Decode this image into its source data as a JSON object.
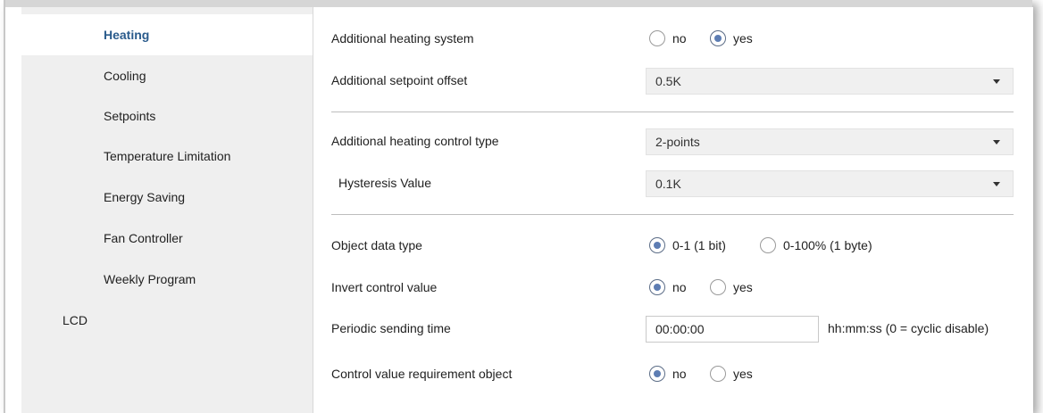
{
  "sidebar": {
    "items": [
      {
        "label": "Heating"
      },
      {
        "label": "Cooling"
      },
      {
        "label": "Setpoints"
      },
      {
        "label": "Temperature Limitation"
      },
      {
        "label": "Energy Saving"
      },
      {
        "label": "Fan Controller"
      },
      {
        "label": "Weekly Program"
      },
      {
        "label": "LCD"
      }
    ],
    "active_index": 0
  },
  "form": {
    "additional_heating_system": {
      "label": "Additional heating system",
      "options": [
        "no",
        "yes"
      ],
      "selected": "yes"
    },
    "additional_setpoint_offset": {
      "label": "Additional setpoint offset",
      "value": "0.5K"
    },
    "additional_heating_control_type": {
      "label": "Additional heating control type",
      "value": "2-points"
    },
    "hysteresis_value": {
      "label": "Hysteresis Value",
      "value": "0.1K"
    },
    "object_data_type": {
      "label": "Object data type",
      "options": [
        "0-1 (1 bit)",
        "0-100% (1 byte)"
      ],
      "selected": "0-1 (1 bit)"
    },
    "invert_control_value": {
      "label": "Invert control value",
      "options": [
        "no",
        "yes"
      ],
      "selected": "no"
    },
    "periodic_sending_time": {
      "label": "Periodic sending time",
      "value": "00:00:00",
      "hint": "hh:mm:ss (0 = cyclic disable)"
    },
    "control_value_requirement_object": {
      "label": "Control value requirement object",
      "options": [
        "no",
        "yes"
      ],
      "selected": "no"
    }
  },
  "colors": {
    "accent": "#2a5b8c",
    "radio_dot": "#5d7db3",
    "sidebar_bg": "#efefef"
  }
}
